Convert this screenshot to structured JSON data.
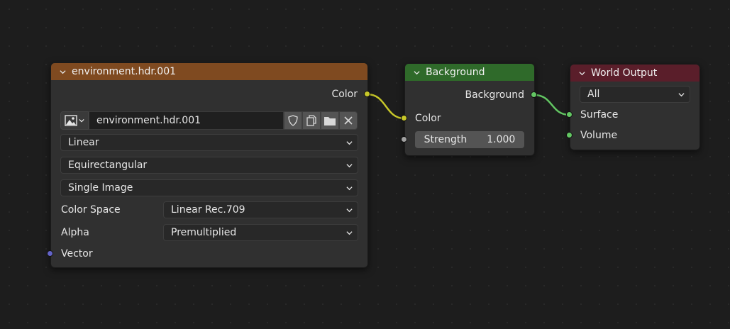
{
  "image_node": {
    "title": "environment.hdr.001",
    "header_color": "#7f4a20",
    "output_color": "Color",
    "image_name": "environment.hdr.001",
    "interpolation": "Linear",
    "projection": "Equirectangular",
    "source": "Single Image",
    "color_space_label": "Color Space",
    "color_space_value": "Linear Rec.709",
    "alpha_label": "Alpha",
    "alpha_value": "Premultiplied",
    "input_vector": "Vector"
  },
  "background_node": {
    "title": "Background",
    "header_color": "#2f6a2a",
    "output_background": "Background",
    "input_color": "Color",
    "strength_label": "Strength",
    "strength_value": "1.000"
  },
  "world_output_node": {
    "title": "World Output",
    "header_color": "#5a1e2a",
    "target": "All",
    "input_surface": "Surface",
    "input_volume": "Volume"
  },
  "icons": [
    "chevron-down-icon",
    "image-icon",
    "shield-icon",
    "duplicate-icon",
    "folder-icon",
    "close-icon"
  ]
}
